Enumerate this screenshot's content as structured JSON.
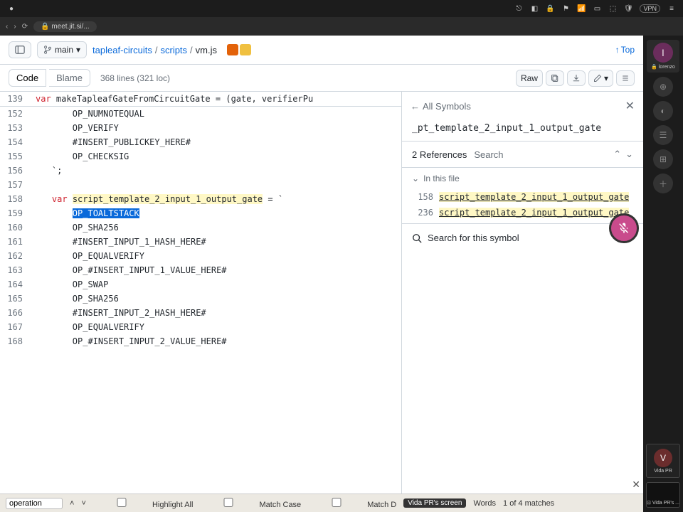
{
  "os_bar": {
    "vpn": "VPN"
  },
  "browser": {
    "url": "meet.jit.si/..."
  },
  "meeting": {
    "host_initial": "l",
    "host_name": "lorenzo",
    "participant_initial": "V",
    "participant_name": "Vida PR",
    "screen_label": "Vida PR's screen",
    "share_caption": "Vida PR's ..."
  },
  "header": {
    "branch": "main",
    "repo": "tapleaf-circuits",
    "folder": "scripts",
    "file": "vm.js",
    "top": "Top"
  },
  "toolbar": {
    "code": "Code",
    "blame": "Blame",
    "meta": "368 lines (321 loc)",
    "raw": "Raw"
  },
  "sticky": {
    "ln": "139",
    "kw": "var",
    "ident": "makeTapleafGateFromCircuitGate",
    "rest": " = (gate, verifierPu"
  },
  "code_lines": [
    {
      "ln": "152",
      "text": "        OP_NUMNOTEQUAL"
    },
    {
      "ln": "153",
      "text": "        OP_VERIFY"
    },
    {
      "ln": "154",
      "text": "        #INSERT_PUBLICKEY_HERE#"
    },
    {
      "ln": "155",
      "text": "        OP_CHECKSIG"
    },
    {
      "ln": "156",
      "text": "    `;"
    },
    {
      "ln": "157",
      "text": ""
    },
    {
      "ln": "158",
      "kw": "var",
      "hl": "script_template_2_input_1_output_gate",
      "rest": " = `"
    },
    {
      "ln": "159",
      "sel": "OP_TOALTSTACK",
      "indent": "        "
    },
    {
      "ln": "160",
      "text": "        OP_SHA256"
    },
    {
      "ln": "161",
      "text": "        #INSERT_INPUT_1_HASH_HERE#"
    },
    {
      "ln": "162",
      "text": "        OP_EQUALVERIFY"
    },
    {
      "ln": "163",
      "text": "        OP_#INSERT_INPUT_1_VALUE_HERE#"
    },
    {
      "ln": "164",
      "text": "        OP_SWAP"
    },
    {
      "ln": "165",
      "text": "        OP_SHA256"
    },
    {
      "ln": "166",
      "text": "        #INSERT_INPUT_2_HASH_HERE#"
    },
    {
      "ln": "167",
      "text": "        OP_EQUALVERIFY"
    },
    {
      "ln": "168",
      "text": "        OP_#INSERT_INPUT_2_VALUE_HERE#"
    }
  ],
  "refs": {
    "back": "All Symbols",
    "symbol": "_pt_template_2_input_1_output_gate",
    "count_label": "2 References",
    "search_tab": "Search",
    "section": "In this file",
    "items": [
      {
        "ln": "158",
        "text": "script_template_2_input_1_output_gate"
      },
      {
        "ln": "236",
        "text": "script_template_2_input_1_output_gate"
      }
    ],
    "search_symbol": "Search for this symbol"
  },
  "findbar": {
    "label": "operation",
    "hl_all": "Highlight All",
    "match_case": "Match Case",
    "match_d": "Match D",
    "tag": "Vida PR's screen",
    "words": "Words",
    "count": "1 of 4 matches"
  }
}
